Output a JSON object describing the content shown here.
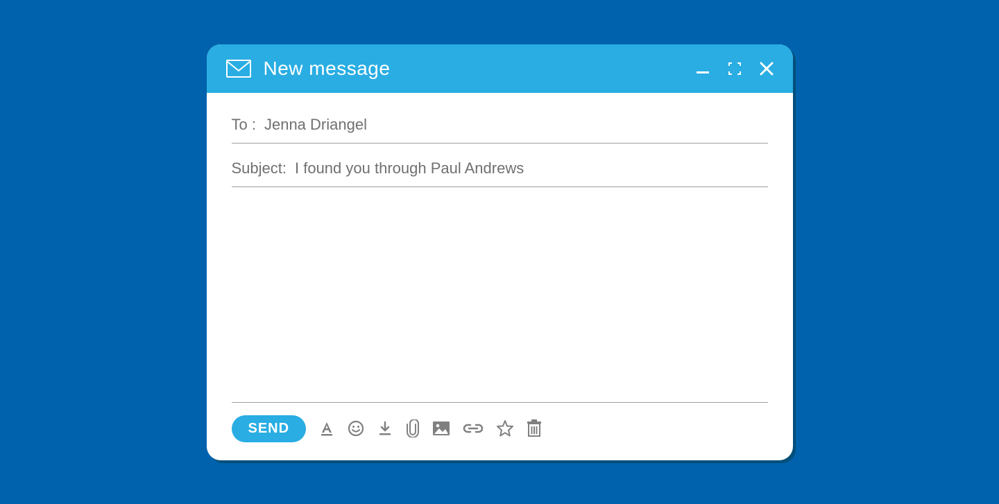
{
  "header": {
    "title": "New message"
  },
  "fields": {
    "to_label": "To :",
    "to_value": "Jenna Driangel",
    "subject_label": "Subject:",
    "subject_value": "I found you through Paul Andrews"
  },
  "body": {
    "content": ""
  },
  "toolbar": {
    "send_label": "SEND"
  }
}
